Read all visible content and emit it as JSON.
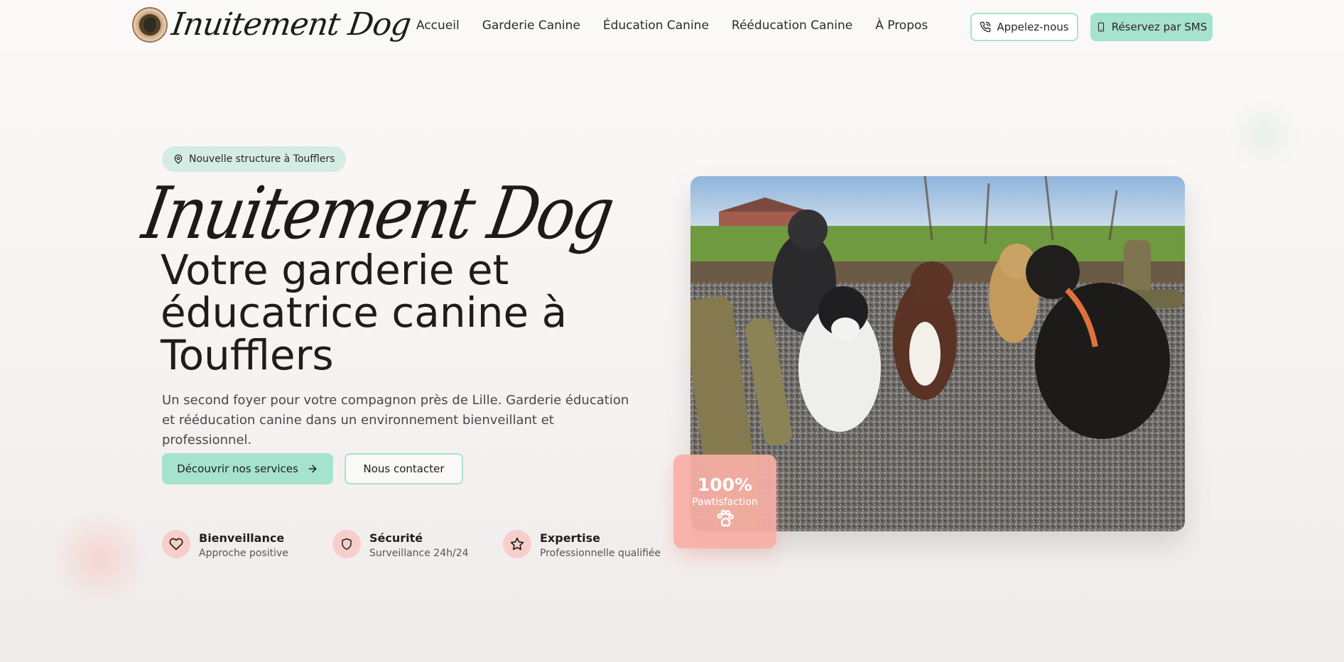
{
  "header": {
    "logo_text": "Inuitement Dog",
    "nav": [
      "Accueil",
      "Garderie Canine",
      "Éducation Canine",
      "Rééducation Canine",
      "À Propos"
    ],
    "call_label": "Appelez-nous",
    "sms_label": "Réservez par SMS"
  },
  "hero": {
    "location_pill": "Nouvelle structure à Toufflers",
    "script_title": "Inuitement Dog",
    "headline": "Votre garderie et éducatrice canine à Toufflers",
    "lead": "Un second foyer pour votre compagnon près de Lille. Garderie éducation et rééducation canine dans un environnement bienveillant et professionnel.",
    "primary_cta": "Découvrir nos services",
    "secondary_cta": "Nous contacter"
  },
  "features": [
    {
      "title": "Bienveillance",
      "subtitle": "Approche positive",
      "icon": "heart-icon"
    },
    {
      "title": "Sécurité",
      "subtitle": "Surveillance 24h/24",
      "icon": "shield-icon"
    },
    {
      "title": "Expertise",
      "subtitle": "Professionnelle qualifiée",
      "icon": "star-icon"
    }
  ],
  "badge": {
    "value": "100%",
    "label": "Pawtisfaction",
    "icon": "paw-icon"
  },
  "colors": {
    "mint": "#a6e3cf",
    "mint_light": "#d4ece3",
    "salmon": "#f8afa5",
    "pink_icon_bg": "#f6cfca",
    "text": "#1f1c1c"
  }
}
